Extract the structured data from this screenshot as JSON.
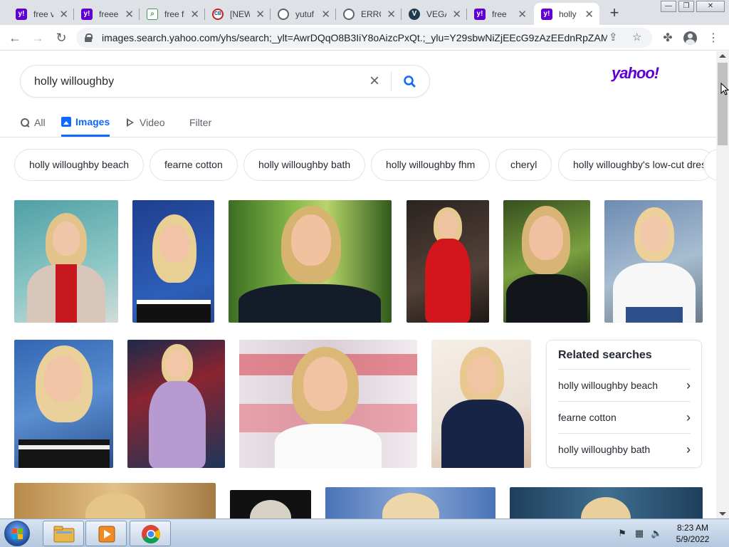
{
  "browser": {
    "tabs": [
      {
        "label": "free v",
        "favicon": "yahoo-icon"
      },
      {
        "label": "freee",
        "favicon": "yahoo-icon"
      },
      {
        "label": "free f",
        "favicon": "search-doc-icon"
      },
      {
        "label": "[NEW",
        "favicon": "news-icon"
      },
      {
        "label": "yutuf",
        "favicon": "globe-icon"
      },
      {
        "label": "ERRO",
        "favicon": "globe-icon"
      },
      {
        "label": "VEGA",
        "favicon": "vega-icon"
      },
      {
        "label": "free",
        "favicon": "yahoo-icon"
      },
      {
        "label": "holly",
        "favicon": "yahoo-icon",
        "active": true
      }
    ],
    "url": "images.search.yahoo.com/yhs/search;_ylt=AwrDQqO8B3IiY8oAizcPxQt.;_ylu=Y29sbwNiZjEEcG9zAzEEdnRpZAMEc..."
  },
  "search": {
    "query": "holly willoughby",
    "logo": "yahoo!"
  },
  "verticals": [
    {
      "label": "All",
      "icon": "search-icon"
    },
    {
      "label": "Images",
      "icon": "image-icon",
      "active": true
    },
    {
      "label": "Video",
      "icon": "play-icon"
    },
    {
      "label": "Filter"
    }
  ],
  "suggestions": [
    "holly willoughby beach",
    "fearne cotton",
    "holly willoughby bath",
    "holly willoughby fhm",
    "cheryl",
    "holly willoughby's low-cut dres"
  ],
  "related_searches": {
    "title": "Related searches",
    "items": [
      "holly willoughby beach",
      "fearne cotton",
      "holly willoughby bath"
    ]
  },
  "taskbar": {
    "time": "8:23 AM",
    "date": "5/9/2022"
  },
  "colors": {
    "yahoo_purple": "#6001d2",
    "active_blue": "#0f69ff"
  }
}
